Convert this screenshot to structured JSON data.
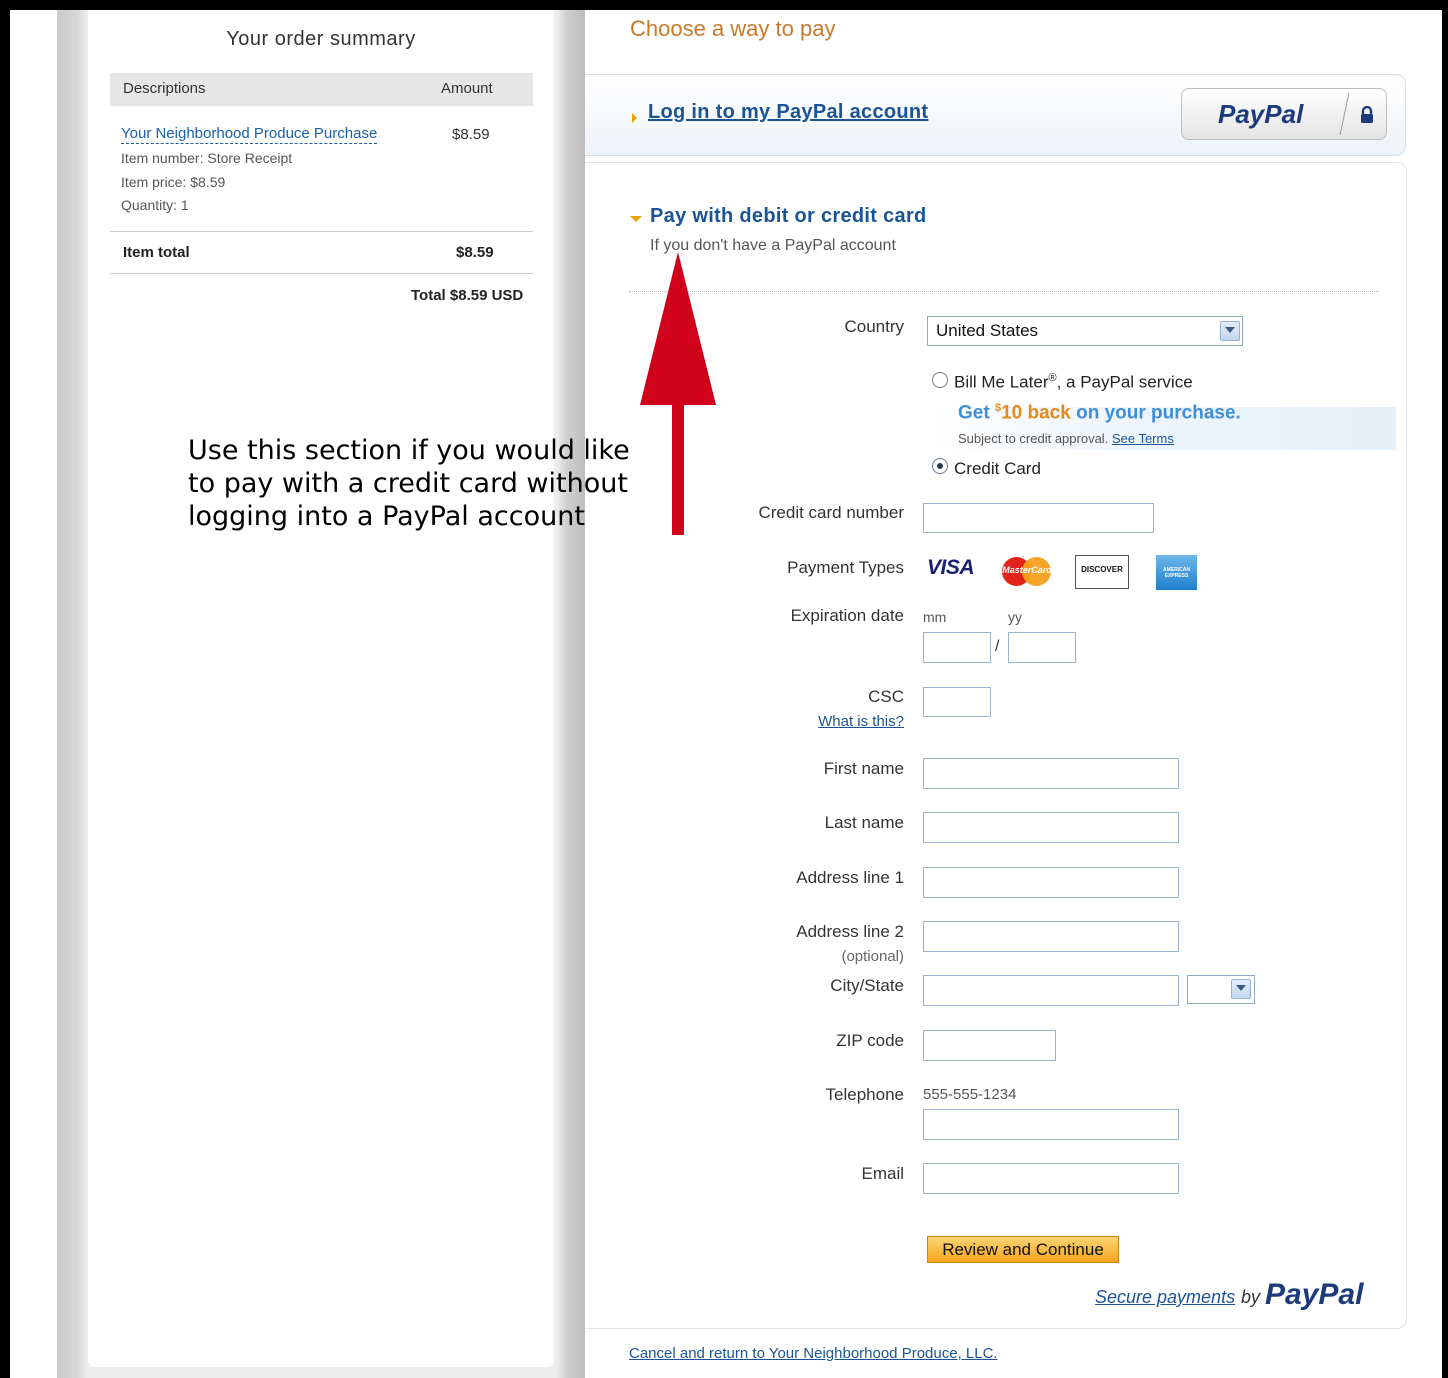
{
  "order_summary": {
    "title": "Your order summary",
    "col_descriptions": "Descriptions",
    "col_amount": "Amount",
    "item": {
      "name": "Your Neighborhood Produce Purchase",
      "amount": "$8.59",
      "item_number": "Item number: Store Receipt",
      "item_price": "Item price: $8.59",
      "quantity": "Quantity: 1"
    },
    "item_total_label": "Item total",
    "item_total_value": "$8.59",
    "grand_total": "Total $8.59 USD"
  },
  "annotation": {
    "line1": "Use this section if you would like",
    "line2": "to pay with a credit card without",
    "line3": "logging into a PayPal account",
    "arrow_color": "#d0021b"
  },
  "payment": {
    "choose_title": "Choose a way to pay",
    "login_link": "Log in to my PayPal account",
    "paypal_badge": "PayPal",
    "card_section_title": "Pay with debit or credit card",
    "card_section_sub": "If you don't have a PayPal account"
  },
  "form": {
    "country_label": "Country",
    "country_value": "United States",
    "bill_me_later_label": "Bill Me Later",
    "bill_me_later_reg": "®",
    "bill_me_later_suffix": ", a PayPal service",
    "promo_get": "Get ",
    "promo_sup": "$",
    "promo_amount": "10 back",
    "promo_rest": " on your purchase.",
    "promo_sub": "Subject to credit approval.",
    "promo_terms": "See Terms",
    "credit_card_label": "Credit Card",
    "card_number_label": "Credit card number",
    "payment_types_label": "Payment Types",
    "card_brands": [
      "VISA",
      "MasterCard",
      "DISCOVER",
      "AMERICAN EXPRESS"
    ],
    "expiration_label": "Expiration date",
    "mm_label": "mm",
    "yy_label": "yy",
    "slash": "/",
    "csc_label": "CSC",
    "what_is_this": "What is this?",
    "first_name_label": "First name",
    "last_name_label": "Last name",
    "address1_label": "Address line 1",
    "address2_label": "Address line 2",
    "optional_label": "(optional)",
    "city_state_label": "City/State",
    "zip_label": "ZIP code",
    "telephone_label": "Telephone",
    "telephone_example": "555-555-1234",
    "email_label": "Email",
    "review_button": "Review and Continue"
  },
  "footer": {
    "secure_link": "Secure payments",
    "secure_by": "by",
    "secure_paypal": "PayPal",
    "cancel_link": "Cancel and return to Your Neighborhood Produce, LLC."
  },
  "colors": {
    "link_blue": "#1a5496",
    "orange_title": "#c7792b",
    "button_orange": "#f4a61f",
    "paypal_navy": "#1d3b7c"
  }
}
